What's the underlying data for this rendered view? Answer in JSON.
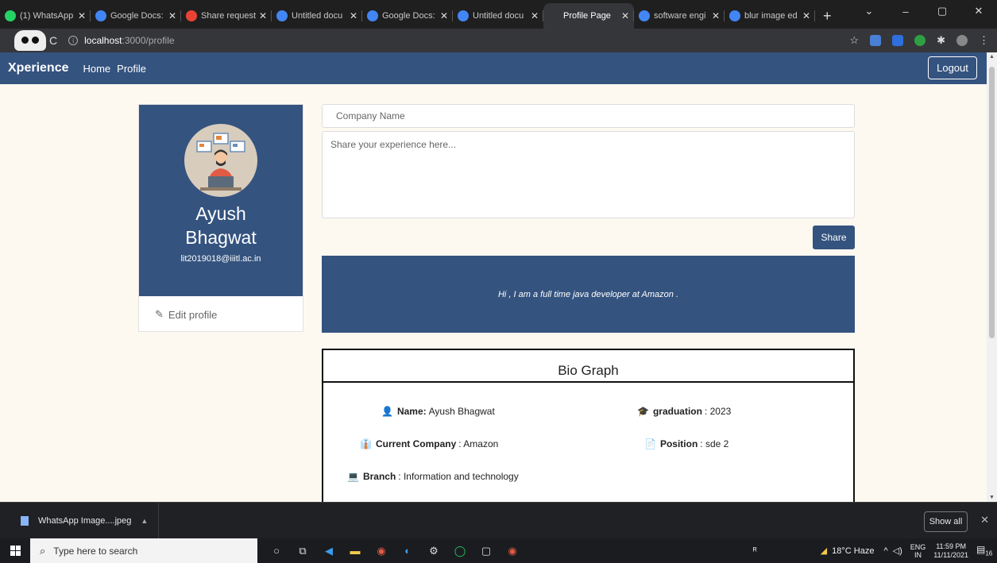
{
  "browser": {
    "tabs": [
      {
        "title": "(1) WhatsApp",
        "icon": "whatsapp-icon",
        "color": "#25d366",
        "active": false
      },
      {
        "title": "Google Docs:",
        "icon": "google-icon",
        "color": "#4285f4",
        "active": false
      },
      {
        "title": "Share request",
        "icon": "gmail-icon",
        "color": "#ea4335",
        "active": false
      },
      {
        "title": "Untitled docu",
        "icon": "docs-icon",
        "color": "#4285f4",
        "active": false
      },
      {
        "title": "Google Docs:",
        "icon": "google-icon",
        "color": "#4285f4",
        "active": false
      },
      {
        "title": "Untitled docu",
        "icon": "docs-icon",
        "color": "#4285f4",
        "active": false
      },
      {
        "title": "Profile Page",
        "icon": "react-icon",
        "color": "#35363a",
        "active": true
      },
      {
        "title": "software engi",
        "icon": "google-icon",
        "color": "#4285f4",
        "active": false
      },
      {
        "title": "blur image ed",
        "icon": "google-icon",
        "color": "#4285f4",
        "active": false
      }
    ],
    "new_tab": "+",
    "url_host": "localhost",
    "url_path": ":3000/profile"
  },
  "navbar": {
    "brand": "Xperience",
    "links": [
      "Home",
      "Profile"
    ],
    "logout": "Logout",
    "color": "#34537f"
  },
  "profile": {
    "name": "Ayush Bhagwat",
    "email": "lit2019018@iiitl.ac.in",
    "edit_label": "Edit profile"
  },
  "form": {
    "company_placeholder": "Company Name",
    "experience_placeholder": "Share your experience here...",
    "share_label": "Share"
  },
  "banner": {
    "text": "Hi , I am a full time java developer at Amazon ."
  },
  "bio_graph": {
    "title": "Bio Graph",
    "fields": [
      {
        "label": "Name:",
        "value": "Ayush Bhagwat",
        "icon": "user-icon"
      },
      {
        "label": "graduation",
        "value": ": 2023",
        "icon": "graduate-icon"
      },
      {
        "label": "Current Company",
        "value": ": Amazon",
        "icon": "user-tie-icon"
      },
      {
        "label": "Position",
        "value": ": sde 2",
        "icon": "file-icon"
      },
      {
        "label": "Branch",
        "value": ": Information and technology",
        "icon": "laptop-icon"
      }
    ]
  },
  "downloads": {
    "file": "WhatsApp Image....jpeg",
    "show_all": "Show all"
  },
  "taskbar": {
    "search_placeholder": "Type here to search",
    "weather": "18°C  Haze",
    "lang_top": "ENG",
    "lang_bottom": "IN",
    "time": "11:59 PM",
    "date": "11/11/2021",
    "notifications": "16"
  }
}
